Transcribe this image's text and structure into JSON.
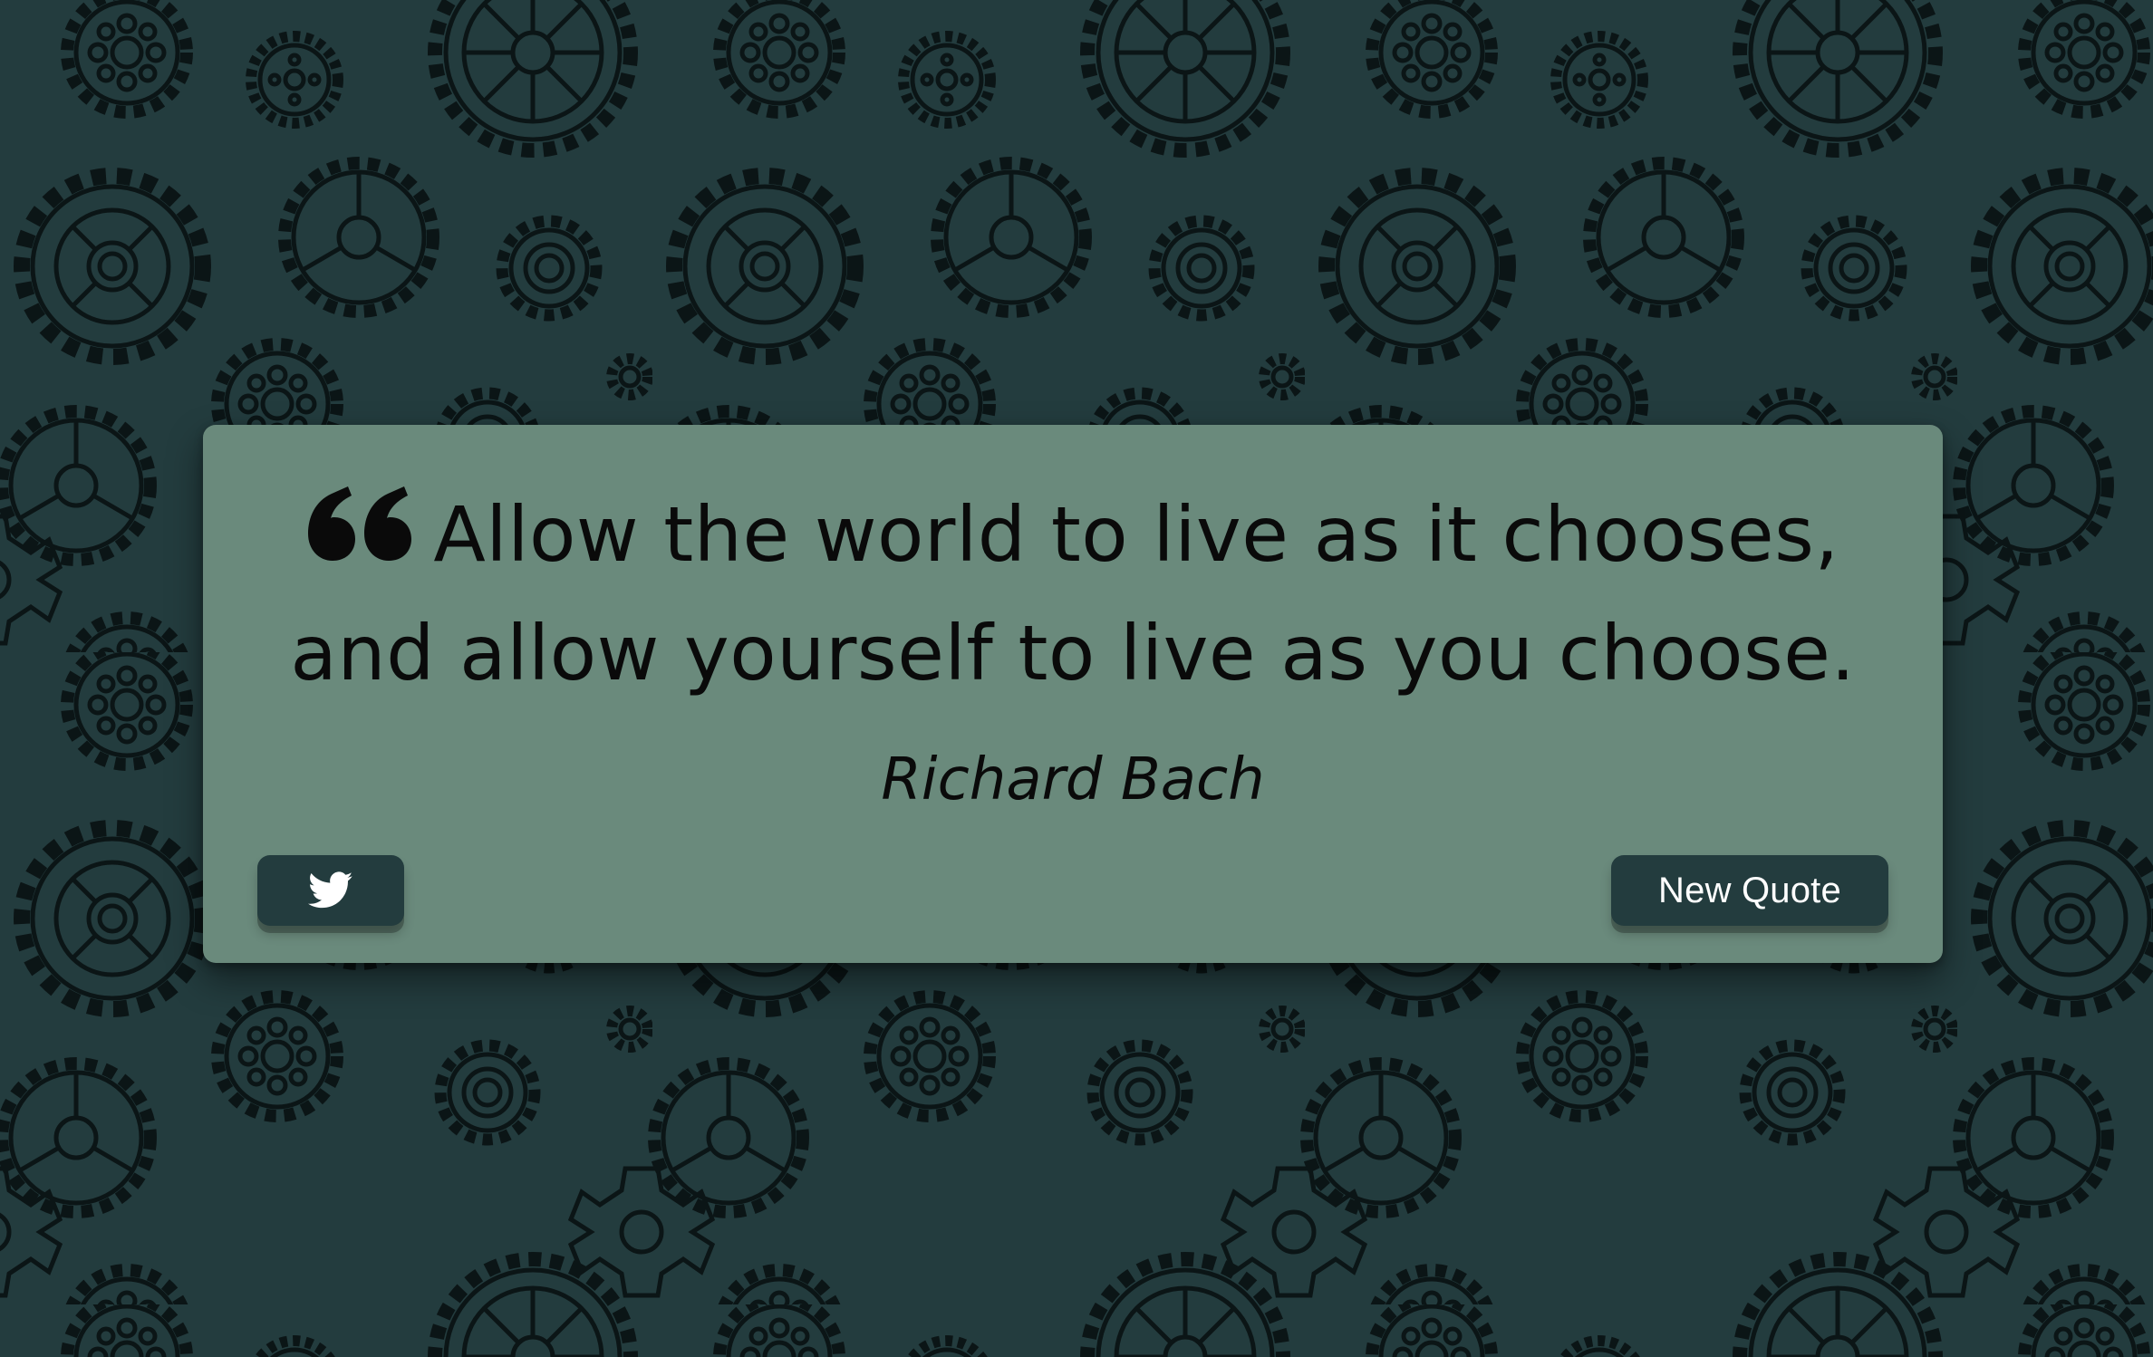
{
  "page": {
    "background_color": "#233c3e",
    "pattern": "gear-pattern",
    "pattern_stroke_color": "#0b1516"
  },
  "quote_box": {
    "background_color": "#6a8a7c",
    "quote_icon": "quote-left-icon",
    "text_line_1": "Allow the world to live as it chooses,",
    "text_line_2": "and allow yourself to live as you choose.",
    "author": "Richard Bach",
    "twitter_icon": "twitter-icon",
    "new_quote_label": "New Quote",
    "button_color": "#233c3e"
  }
}
